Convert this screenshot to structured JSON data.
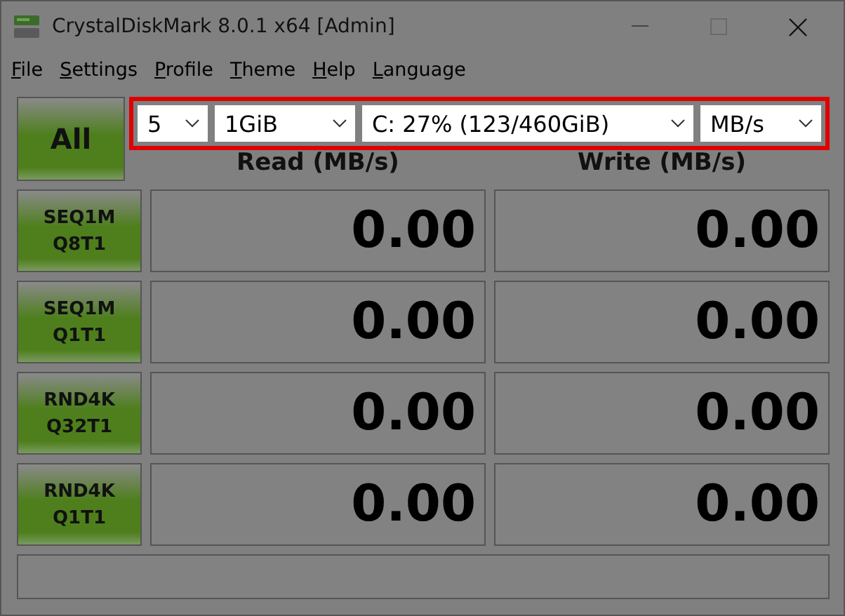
{
  "window": {
    "title": "CrystalDiskMark 8.0.1 x64 [Admin]"
  },
  "menu": [
    "File",
    "Settings",
    "Profile",
    "Theme",
    "Help",
    "Language"
  ],
  "all_button": "All",
  "selectors": [
    {
      "value": "5"
    },
    {
      "value": "1GiB"
    },
    {
      "value": "C: 27% (123/460GiB)"
    },
    {
      "value": "MB/s"
    }
  ],
  "selectors_highlighted": true,
  "columns": [
    "Read (MB/s)",
    "Write (MB/s)"
  ],
  "tests": [
    {
      "line1": "SEQ1M",
      "line2": "Q8T1",
      "read": "0.00",
      "write": "0.00"
    },
    {
      "line1": "SEQ1M",
      "line2": "Q1T1",
      "read": "0.00",
      "write": "0.00"
    },
    {
      "line1": "RND4K",
      "line2": "Q32T1",
      "read": "0.00",
      "write": "0.00"
    },
    {
      "line1": "RND4K",
      "line2": "Q1T1",
      "read": "0.00",
      "write": "0.00"
    }
  ]
}
